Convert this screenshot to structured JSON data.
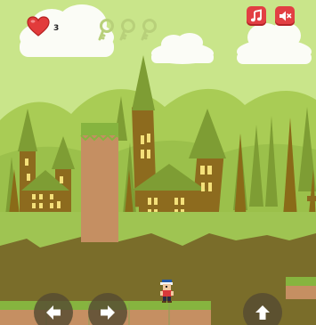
{
  "hud": {
    "lives_icon": "heart-icon",
    "lives_count": "3",
    "keys": [
      {
        "icon": "key-icon",
        "collected": false
      },
      {
        "icon": "key-icon",
        "collected": false
      },
      {
        "icon": "key-icon",
        "collected": false
      }
    ],
    "music_button_icon": "music-note-icon",
    "sound_button_icon": "speaker-muted-icon"
  },
  "controls": {
    "left_icon": "arrow-left-icon",
    "right_icon": "arrow-right-icon",
    "jump_icon": "arrow-up-icon"
  },
  "colors": {
    "sky": "#c9e58a",
    "hills_far": "#a9cc55",
    "hills_near": "#9bc04b",
    "trees": "#7e9d34",
    "ground_earth": "#7a6d2a",
    "grass": "#86b43f",
    "dirt": "#c58f62",
    "brick_house": "#8d6b1e",
    "window": "#f4e07a",
    "heart": "#e23b3b",
    "hud_button": "#e23f43",
    "control_button": "#554b32"
  }
}
